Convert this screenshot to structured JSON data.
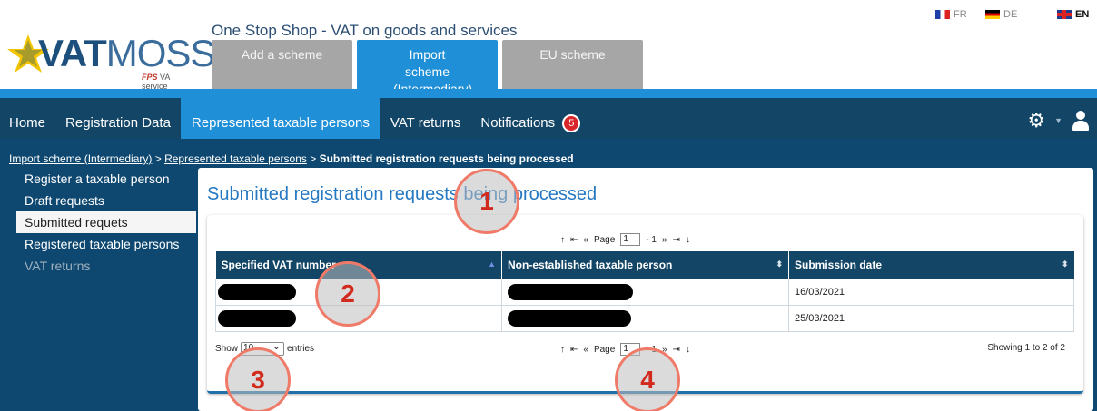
{
  "header": {
    "logo_bold": "VAT",
    "logo_light": "MOSS",
    "logo_sub_prefix": "FPS",
    "logo_sub_suffix": "VA service",
    "site_title": "One Stop Shop - VAT on goods and services",
    "tabs": [
      {
        "label": "Add a scheme"
      },
      {
        "label": "Import scheme (Intermediary)",
        "active": true
      },
      {
        "label": "EU scheme"
      }
    ],
    "languages": [
      {
        "code": "FR",
        "flag": "flag-fr-icon"
      },
      {
        "code": "DE",
        "flag": "flag-de-icon"
      },
      {
        "code": "EN",
        "flag": "flag-en-icon",
        "active": true
      }
    ]
  },
  "nav": {
    "items": [
      {
        "label": "Home"
      },
      {
        "label": "Registration Data"
      },
      {
        "label": "Represented taxable persons",
        "active": true
      },
      {
        "label": "VAT returns"
      },
      {
        "label": "Notifications"
      }
    ],
    "notification_count": "5",
    "settings_icon": "gear-icon",
    "user_icon": "user-icon"
  },
  "breadcrumb": {
    "link1": "Import scheme (Intermediary)",
    "sep": ">",
    "link2": "Represented taxable persons",
    "current": "Submitted registration requests being processed"
  },
  "sidebar": {
    "items": [
      {
        "label": "Register a taxable person"
      },
      {
        "label": "Draft requests"
      },
      {
        "label": "Submitted requets",
        "active": true
      },
      {
        "label": "Registered taxable persons"
      },
      {
        "label": "VAT returns",
        "disabled": true
      }
    ]
  },
  "main": {
    "title": "Submitted registration requests being processed",
    "pager": {
      "page_label": "Page",
      "page_value": "1",
      "of_text": "- 1"
    },
    "table": {
      "columns": [
        "Specified VAT number",
        "Non-established taxable person",
        "Submission date"
      ],
      "rows": [
        {
          "vat": "",
          "person": "",
          "date": "16/03/2021"
        },
        {
          "vat": "",
          "person": "",
          "date": "25/03/2021"
        }
      ]
    },
    "show_prefix": "Show",
    "entries_value": "10",
    "show_suffix": "entries",
    "showing_text": "Showing 1 to 2 of 2"
  },
  "annotations": [
    "1",
    "2",
    "3",
    "4"
  ],
  "colors": {
    "accent": "#1f8fd8",
    "navbar": "#124566",
    "annotation": "#f07a68"
  }
}
